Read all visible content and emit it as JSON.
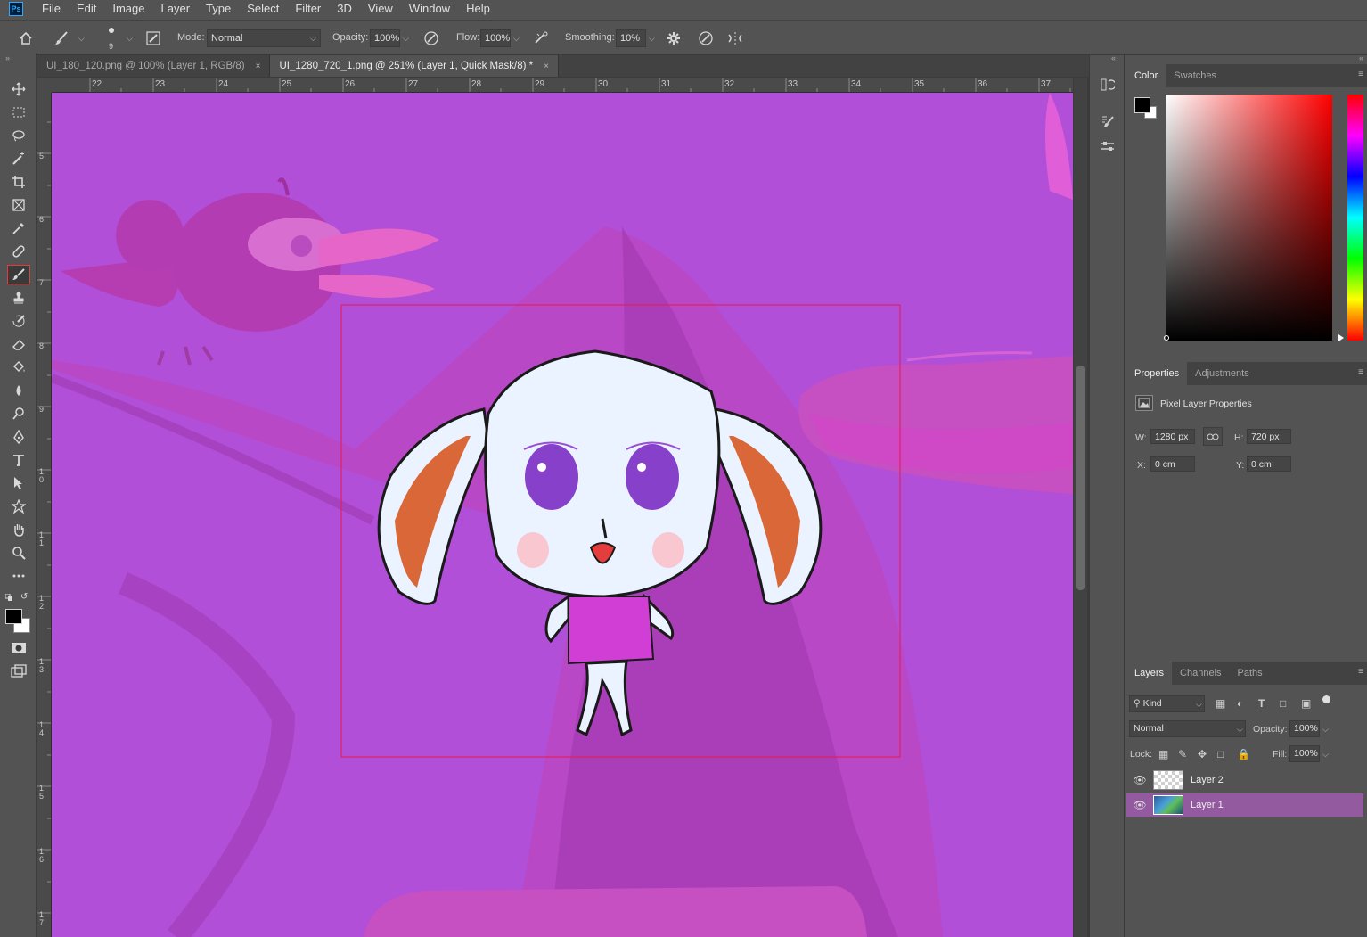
{
  "menubar": {
    "logo": "Ps",
    "items": [
      "File",
      "Edit",
      "Image",
      "Layer",
      "Type",
      "Select",
      "Filter",
      "3D",
      "View",
      "Window",
      "Help"
    ]
  },
  "options": {
    "brush_size": "9",
    "mode_label": "Mode:",
    "mode_value": "Normal",
    "opacity_label": "Opacity:",
    "opacity_value": "100%",
    "flow_label": "Flow:",
    "flow_value": "100%",
    "smoothing_label": "Smoothing:",
    "smoothing_value": "10%"
  },
  "tabs": [
    {
      "label": "UI_180_120.png @ 100% (Layer 1, RGB/8)",
      "close": "×"
    },
    {
      "label": "UI_1280_720_1.png @ 251% (Layer 1, Quick Mask/8) *",
      "close": "×"
    }
  ],
  "ruler_top": [
    "22",
    "23",
    "24",
    "25",
    "26",
    "27",
    "28",
    "29",
    "30",
    "31",
    "32",
    "33",
    "34",
    "35",
    "36",
    "37"
  ],
  "ruler_left": [
    "5",
    "6",
    "7",
    "8",
    "9",
    "1 0",
    "1 1",
    "1 2",
    "1 3",
    "1 4",
    "1 5",
    "1 6",
    "1 7"
  ],
  "color_panel": {
    "tabs": [
      "Color",
      "Swatches"
    ],
    "foreground": "#000000",
    "background": "#ffffff",
    "hue_base": "#ff0000"
  },
  "properties_panel": {
    "tabs": [
      "Properties",
      "Adjustments"
    ],
    "title": "Pixel Layer Properties",
    "w_label": "W:",
    "w_value": "1280 px",
    "h_label": "H:",
    "h_value": "720 px",
    "x_label": "X:",
    "x_value": "0 cm",
    "y_label": "Y:",
    "y_value": "0 cm"
  },
  "layers_panel": {
    "tabs": [
      "Layers",
      "Channels",
      "Paths"
    ],
    "kind_value": "Kind",
    "blend_value": "Normal",
    "opacity_label": "Opacity:",
    "opacity_value": "100%",
    "lock_label": "Lock:",
    "fill_label": "Fill:",
    "fill_value": "100%",
    "layers": [
      {
        "name": "Layer 2",
        "selected": false
      },
      {
        "name": "Layer 1",
        "selected": true
      }
    ]
  },
  "colors": {
    "quick_mask_tint": "#b24fd8",
    "selection_rect": "#e8194a",
    "active_tool_outline": "#e23b3b",
    "selected_layer": "#935aa0"
  }
}
